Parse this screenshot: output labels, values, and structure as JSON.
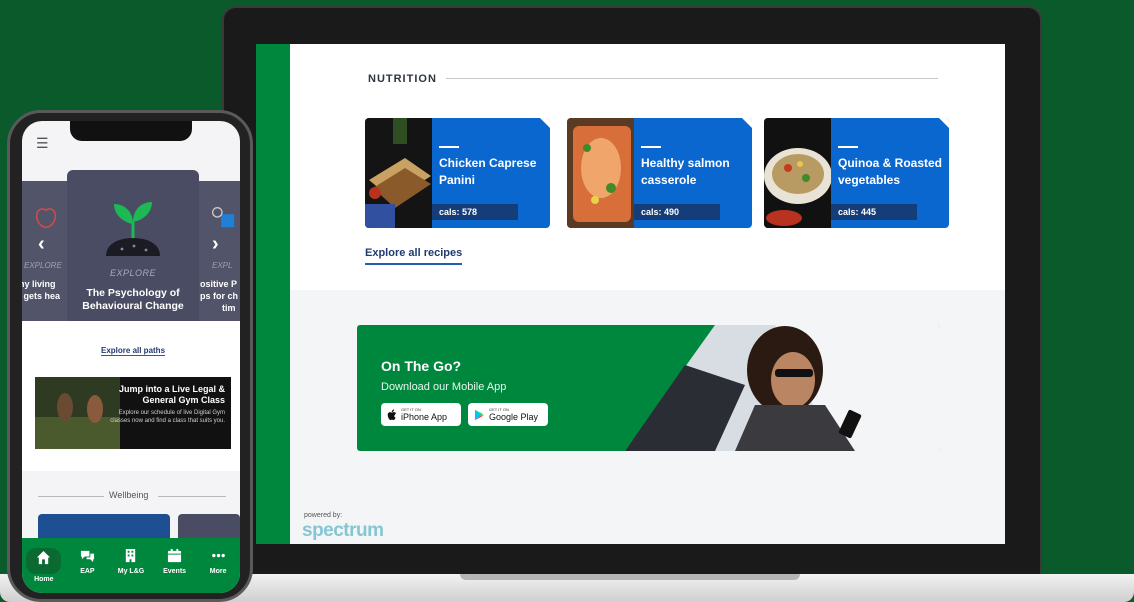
{
  "nutrition": {
    "section_title": "NUTRITION",
    "recipes": [
      {
        "title": "Chicken Caprese Panini",
        "cals": "cals: 578"
      },
      {
        "title": "Healthy salmon casserole",
        "cals": "cals: 490"
      },
      {
        "title": "Quinoa & Roasted vegetables",
        "cals": "cals: 445"
      }
    ],
    "explore_link": "Explore all recipes"
  },
  "promo": {
    "title": "On The Go?",
    "subtitle": "Download our Mobile App",
    "ios_small": "GET IT ON",
    "ios_label": "iPhone App",
    "android_small": "GET IT ON",
    "android_label": "Google Play"
  },
  "footer": {
    "powered_by": "powered by:",
    "brand": "spectrum"
  },
  "phone": {
    "left_card": {
      "label": "EXPLORE",
      "title_line1": "thy living",
      "title_line2": "e gets hea"
    },
    "center_card": {
      "label": "EXPLORE",
      "title": "The Psychology of Behavioural Change"
    },
    "right_card": {
      "label": "EXPL",
      "title_line1": "ositive P",
      "title_line2": "ps for ch",
      "title_line3": "tim"
    },
    "explore_paths": "Explore all paths",
    "gym": {
      "heading": "Jump into a Live Legal & General Gym Class",
      "body": "Explore our schedule of live Digital Gym classes now and find a class that suits you."
    },
    "section_wellbeing": "Wellbeing",
    "nav": [
      {
        "label": "Home",
        "icon": "home-icon"
      },
      {
        "label": "EAP",
        "icon": "chat-icon"
      },
      {
        "label": "My L&G",
        "icon": "building-icon"
      },
      {
        "label": "Events",
        "icon": "calendar-icon"
      },
      {
        "label": "More",
        "icon": "more-icon"
      }
    ]
  },
  "colors": {
    "background_green": "#0b5a2c",
    "brand_green": "#00873e",
    "recipe_blue": "#0b67d0",
    "path_card": "#4a4c63"
  }
}
